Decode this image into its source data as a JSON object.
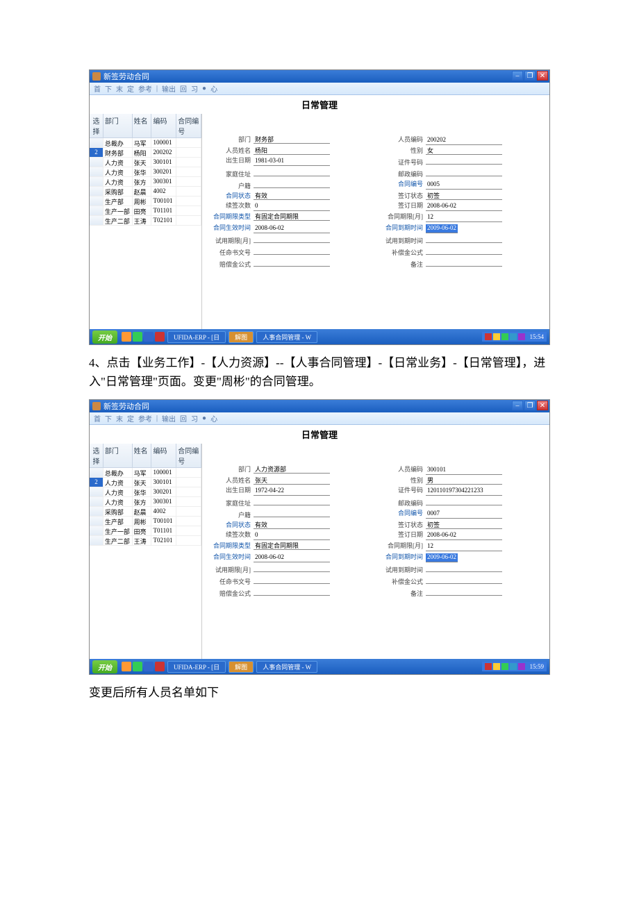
{
  "screenshot1": {
    "title": "新签劳动合同",
    "toolbar": [
      "首",
      "下",
      "末",
      "定",
      "参考",
      "|",
      "输出",
      "回",
      "习",
      "●",
      "心"
    ],
    "page_title": "日常管理",
    "grid_headers": [
      "选择",
      "部门",
      "姓名",
      "编码",
      "合同编号"
    ],
    "rows": [
      {
        "num": "",
        "dept": "总裁办",
        "name": "马军",
        "code": "100001",
        "cno": ""
      },
      {
        "num": "2",
        "dept": "财务部",
        "name": "杨阳",
        "code": "200202",
        "cno": "",
        "sel": true
      },
      {
        "num": "",
        "dept": "人力资",
        "name": "张天",
        "code": "300101",
        "cno": ""
      },
      {
        "num": "",
        "dept": "人力资",
        "name": "张华",
        "code": "300201",
        "cno": ""
      },
      {
        "num": "",
        "dept": "人力资",
        "name": "张方",
        "code": "300301",
        "cno": ""
      },
      {
        "num": "",
        "dept": "采购部",
        "name": "赵晨",
        "code": "4002",
        "cno": ""
      },
      {
        "num": "",
        "dept": "生产部",
        "name": "周彬",
        "code": "T00101",
        "cno": ""
      },
      {
        "num": "",
        "dept": "生产一部",
        "name": "田亮",
        "code": "T01101",
        "cno": ""
      },
      {
        "num": "",
        "dept": "生产二部",
        "name": "王涛",
        "code": "T02101",
        "cno": ""
      }
    ],
    "fields_left": [
      {
        "lbl": "部门",
        "val": "财务部",
        "blue": false
      },
      {
        "lbl": "人员姓名",
        "val": "杨阳",
        "blue": false
      },
      {
        "lbl": "出生日期",
        "val": "1981-03-01",
        "blue": false
      },
      {
        "lbl": "家庭住址",
        "val": "",
        "blue": false
      },
      {
        "lbl": "户籍",
        "val": "",
        "blue": false
      },
      {
        "lbl": "合同状态",
        "val": "有效",
        "blue": true
      },
      {
        "lbl": "续签次数",
        "val": "0",
        "blue": false
      },
      {
        "lbl": "合同期限类型",
        "val": "有固定合同期限",
        "blue": true
      },
      {
        "lbl": "合同生效时间",
        "val": "2008-06-02",
        "blue": true
      },
      {
        "lbl": "试用期限[月]",
        "val": "",
        "blue": false
      },
      {
        "lbl": "任命书文号",
        "val": "",
        "blue": false
      },
      {
        "lbl": "赔偿金公式",
        "val": "",
        "blue": false
      }
    ],
    "fields_right": [
      {
        "lbl": "人员编码",
        "val": "200202",
        "blue": false
      },
      {
        "lbl": "性别",
        "val": "女",
        "blue": false
      },
      {
        "lbl": "证件号码",
        "val": "",
        "blue": false
      },
      {
        "lbl": "邮政编码",
        "val": "",
        "blue": false
      },
      {
        "lbl": "合同编号",
        "val": "0005",
        "blue": true
      },
      {
        "lbl": "签订状态",
        "val": "初签",
        "blue": false
      },
      {
        "lbl": "签订日期",
        "val": "2008-06-02",
        "blue": false
      },
      {
        "lbl": "合同期限[月]",
        "val": "12",
        "blue": false
      },
      {
        "lbl": "合同到期时间",
        "val": "2009-06-02",
        "blue": true,
        "hl": true
      },
      {
        "lbl": "试用到期时间",
        "val": "",
        "blue": false
      },
      {
        "lbl": "补偿金公式",
        "val": "",
        "blue": false
      },
      {
        "lbl": "备注",
        "val": "",
        "blue": false
      }
    ],
    "taskbar": {
      "start": "开始",
      "erp": "UFIDA-ERP - [日",
      "t1": "解图",
      "t2": "人事合同管理 - W",
      "clock": "15:54"
    }
  },
  "instruction": "4、点击【业务工作】-【人力资源】--【人事合同管理】-【日常业务】-【日常管理】，进入\"日常管理\"页面。变更\"周彬\"的合同管理。",
  "screenshot2": {
    "title": "新签劳动合同",
    "toolbar": [
      "首",
      "下",
      "末",
      "定",
      "参考",
      "|",
      "输出",
      "回",
      "习",
      "●",
      "心"
    ],
    "page_title": "日常管理",
    "grid_headers": [
      "选择",
      "部门",
      "姓名",
      "编码",
      "合同编号"
    ],
    "rows": [
      {
        "num": "",
        "dept": "总裁办",
        "name": "马军",
        "code": "100001",
        "cno": ""
      },
      {
        "num": "2",
        "dept": "人力资",
        "name": "张天",
        "code": "300101",
        "cno": "",
        "sel": true
      },
      {
        "num": "",
        "dept": "人力资",
        "name": "张华",
        "code": "300201",
        "cno": ""
      },
      {
        "num": "",
        "dept": "人力资",
        "name": "张方",
        "code": "300301",
        "cno": ""
      },
      {
        "num": "",
        "dept": "采购部",
        "name": "赵晨",
        "code": "4002",
        "cno": ""
      },
      {
        "num": "",
        "dept": "生产部",
        "name": "周彬",
        "code": "T00101",
        "cno": ""
      },
      {
        "num": "",
        "dept": "生产一部",
        "name": "田亮",
        "code": "T01101",
        "cno": ""
      },
      {
        "num": "",
        "dept": "生产二部",
        "name": "王涛",
        "code": "T02101",
        "cno": ""
      }
    ],
    "fields_left": [
      {
        "lbl": "部门",
        "val": "人力资源部",
        "blue": false
      },
      {
        "lbl": "人员姓名",
        "val": "张天",
        "blue": false
      },
      {
        "lbl": "出生日期",
        "val": "1972-04-22",
        "blue": false
      },
      {
        "lbl": "家庭住址",
        "val": "",
        "blue": false
      },
      {
        "lbl": "户籍",
        "val": "",
        "blue": false
      },
      {
        "lbl": "合同状态",
        "val": "有效",
        "blue": true
      },
      {
        "lbl": "续签次数",
        "val": "0",
        "blue": false
      },
      {
        "lbl": "合同期限类型",
        "val": "有固定合同期限",
        "blue": true
      },
      {
        "lbl": "合同生效时间",
        "val": "2008-06-02",
        "blue": true
      },
      {
        "lbl": "试用期限[月]",
        "val": "",
        "blue": false
      },
      {
        "lbl": "任命书文号",
        "val": "",
        "blue": false
      },
      {
        "lbl": "赔偿金公式",
        "val": "",
        "blue": false
      }
    ],
    "fields_right": [
      {
        "lbl": "人员编码",
        "val": "300101",
        "blue": false
      },
      {
        "lbl": "性别",
        "val": "男",
        "blue": false
      },
      {
        "lbl": "证件号码",
        "val": "120110197304221233",
        "blue": false
      },
      {
        "lbl": "邮政编码",
        "val": "",
        "blue": false
      },
      {
        "lbl": "合同编号",
        "val": "0007",
        "blue": true
      },
      {
        "lbl": "签订状态",
        "val": "初签",
        "blue": false
      },
      {
        "lbl": "签订日期",
        "val": "2008-06-02",
        "blue": false
      },
      {
        "lbl": "合同期限[月]",
        "val": "12",
        "blue": false
      },
      {
        "lbl": "合同到期时间",
        "val": "2009-06-02",
        "blue": true,
        "hl": true
      },
      {
        "lbl": "试用到期时间",
        "val": "",
        "blue": false
      },
      {
        "lbl": "补偿金公式",
        "val": "",
        "blue": false
      },
      {
        "lbl": "备注",
        "val": "",
        "blue": false
      }
    ],
    "taskbar": {
      "start": "开始",
      "erp": "UFIDA-ERP - [日",
      "t1": "解图",
      "t2": "人事合同管理 - W",
      "clock": "15:59"
    }
  },
  "footer_text": "变更后所有人员名单如下"
}
